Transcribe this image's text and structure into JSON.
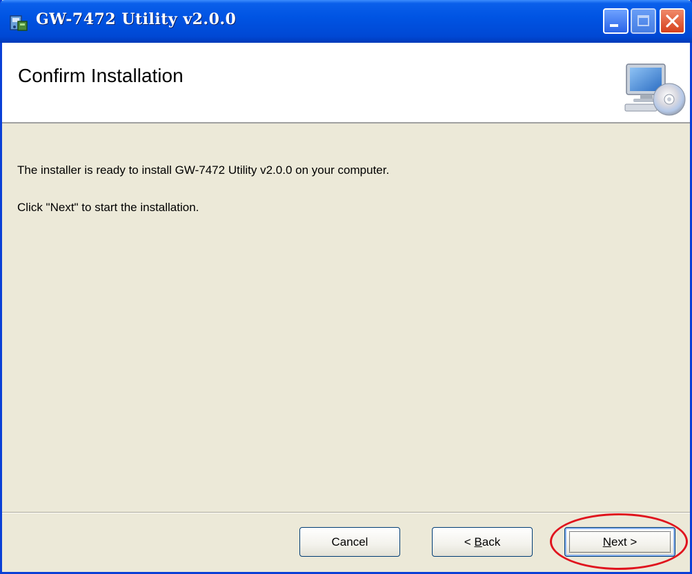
{
  "window": {
    "title": "GW-7472 Utility v2.0.0",
    "controls": {
      "minimize": "minimize-icon",
      "maximize": "maximize-icon",
      "close": "close-icon"
    }
  },
  "header": {
    "title": "Confirm Installation",
    "icon": "computer-cd-icon"
  },
  "body": {
    "line1": "The installer is ready to install GW-7472 Utility v2.0.0 on your computer.",
    "line2": "Click \"Next\" to start the installation."
  },
  "buttons": {
    "cancel": "Cancel",
    "back_prefix": "< ",
    "back_accel": "B",
    "back_rest": "ack",
    "next_accel": "N",
    "next_rest": "ext >"
  },
  "colors": {
    "titlebar": "#0054e3",
    "dialog_bg": "#ece9d8",
    "annotation": "#e0141e"
  }
}
